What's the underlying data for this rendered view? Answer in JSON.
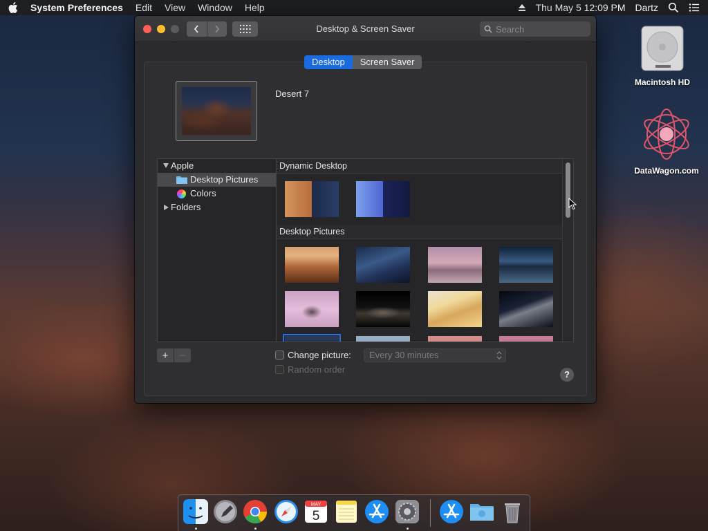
{
  "menubar": {
    "app_name": "System Preferences",
    "menus": [
      "Edit",
      "View",
      "Window",
      "Help"
    ],
    "clock": "Thu May 5  12:09 PM",
    "user": "Dartz"
  },
  "desktop_icons": [
    {
      "label": "Macintosh HD",
      "icon": "hard-drive-icon"
    },
    {
      "label": "DataWagon.com",
      "icon": "datawagon-icon"
    }
  ],
  "window": {
    "title": "Desktop & Screen Saver",
    "search_placeholder": "Search",
    "tabs": [
      {
        "label": "Desktop",
        "active": true
      },
      {
        "label": "Screen Saver",
        "active": false
      }
    ],
    "current_picture": "Desert 7",
    "sources": [
      {
        "label": "Apple",
        "expanded": true
      },
      {
        "label": "Desktop Pictures",
        "selected": true
      },
      {
        "label": "Colors"
      },
      {
        "label": "Folders",
        "expanded": false
      }
    ],
    "sections": {
      "dynamic": "Dynamic Desktop",
      "desktop_pictures": "Desktop Pictures"
    },
    "add_label": "+",
    "remove_label": "−",
    "change_picture_label": "Change picture:",
    "change_interval": "Every 30 minutes",
    "random_order_label": "Random order",
    "help_label": "?"
  },
  "dock": {
    "apps": [
      "Finder",
      "Launchpad",
      "Google Chrome",
      "Safari",
      "Calendar",
      "Notes",
      "App Store",
      "System Preferences",
      "Downloads",
      "Folder",
      "Trash"
    ],
    "calendar_month": "MAY",
    "calendar_day": "5"
  },
  "colors": {
    "accent": "#1a6ae0",
    "close": "#fe5f57",
    "minimize": "#febc2e"
  }
}
